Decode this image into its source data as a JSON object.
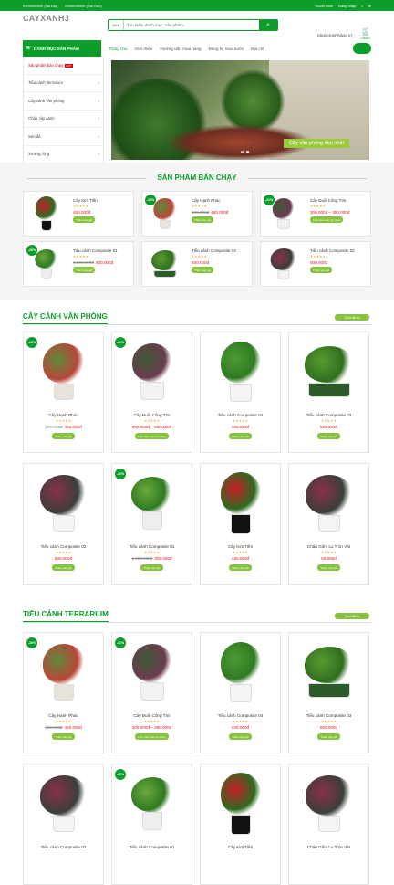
{
  "topbar": {
    "hn": "0909098909 (Hà Nội)",
    "sg": "0909098909 (Sài Gòn)",
    "pay": "Thanh toán",
    "signin": "Đăng nhập",
    "fb": "f",
    "tw": "tw"
  },
  "header": {
    "logo": "CAYXANH3",
    "search_select": "All",
    "search_placeholder": "Tìm kiếm danh mục, sản phẩm...",
    "search_icon": "search-icon",
    "account": "ĐĂNG NHẬP/ĐĂNG KÝ",
    "cart": "GIỎ HÀNG",
    "cart_count": "0"
  },
  "nav": {
    "category_btn": "DANH MỤC SẢN PHẨM",
    "items": [
      "Trang chủ",
      "Giới thiệu",
      "Hướng dẫn mua hàng",
      "Đăng ký mua buôn",
      "Địa chỉ"
    ]
  },
  "categories": [
    "Sản phẩm bán chạy",
    "Tiểu cảnh Terrarium",
    "Cây cảnh văn phòng",
    "Chậu cây cảnh",
    "Sen đá",
    "Xương rồng",
    "Phụ kiện tiểu cảnh"
  ],
  "hot_label": "HOT",
  "hero": {
    "tag": "Cây văn phòng đẹp nhất"
  },
  "bestseller": {
    "title": "SẢN PHẨM BÁN CHẠY",
    "items": [
      {
        "name": "Cây Kim Tiền",
        "old": "",
        "price": "450.000đ",
        "btn": "Thêm vào giỏ",
        "sale": ""
      },
      {
        "name": "Cây Hạnh Phúc",
        "old": "500.000đ",
        "price": "450.000đ",
        "btn": "Thêm vào giỏ",
        "sale": "-10%"
      },
      {
        "name": "Cây Đuôi Công Tím",
        "old": "",
        "price": "300.000đ – 390.000đ",
        "btn": "Lựa chọn các tùy chọn",
        "sale": "-21%"
      },
      {
        "name": "Tiểu cảnh Composite 01",
        "old": "1.000.000đ",
        "price": "800.000đ",
        "btn": "Thêm vào giỏ",
        "sale": "-20%"
      },
      {
        "name": "Tiểu cảnh Composite 03",
        "old": "",
        "price": "500.000đ",
        "btn": "Thêm vào giỏ",
        "sale": ""
      },
      {
        "name": "Tiểu cảnh Composite 02",
        "old": "",
        "price": "500.000đ",
        "btn": "Thêm vào giỏ",
        "sale": ""
      }
    ]
  },
  "office": {
    "title": "CÂY CẢNH VĂN PHÒNG",
    "viewall": "Xem tất cả",
    "items": [
      {
        "name": "Cây Hạnh Phúc",
        "old": "500.000đ",
        "price": "450.000đ",
        "btn": "Thêm vào giỏ",
        "sale": "-10%"
      },
      {
        "name": "Cây Đuôi Công Tím",
        "old": "",
        "price": "300.000đ – 390.000đ",
        "btn": "Lựa chọn các tùy chọn",
        "sale": "-21%"
      },
      {
        "name": "Tiểu cảnh Composite 04",
        "old": "",
        "price": "500.000đ",
        "btn": "Thêm vào giỏ",
        "sale": ""
      },
      {
        "name": "Tiểu cảnh Composite 03",
        "old": "",
        "price": "500.000đ",
        "btn": "Thêm vào giỏ",
        "sale": ""
      },
      {
        "name": "Tiểu cảnh Composite 02",
        "old": "",
        "price": "500.000đ",
        "btn": "Thêm vào giỏ",
        "sale": ""
      },
      {
        "name": "Tiểu cảnh Composite 01",
        "old": "1.000.000đ",
        "price": "800.000đ",
        "btn": "Thêm vào giỏ",
        "sale": "-20%"
      },
      {
        "name": "Cây Kim Tiền",
        "old": "",
        "price": "450.000đ",
        "btn": "Thêm vào giỏ",
        "sale": ""
      },
      {
        "name": "Chậu Gốm Lu Tròn Vát",
        "old": "",
        "price": "50.000đ",
        "btn": "Thêm vào giỏ",
        "sale": ""
      }
    ]
  },
  "terrarium": {
    "title": "TIỂU CẢNH TERRARIUM",
    "viewall": "Xem tất cả",
    "items": [
      {
        "name": "Cây Hạnh Phúc",
        "old": "500.000đ",
        "price": "450.000đ",
        "btn": "Thêm vào giỏ",
        "sale": "-10%"
      },
      {
        "name": "Cây Đuôi Công Tím",
        "old": "",
        "price": "300.000đ – 390.000đ",
        "btn": "Lựa chọn các tùy chọn",
        "sale": "-21%"
      },
      {
        "name": "Tiểu cảnh Composite 04",
        "old": "",
        "price": "500.000đ",
        "btn": "Thêm vào giỏ",
        "sale": ""
      },
      {
        "name": "Tiểu cảnh Composite 03",
        "old": "",
        "price": "500.000đ",
        "btn": "Thêm vào giỏ",
        "sale": ""
      },
      {
        "name": "Tiểu cảnh Composite 02",
        "old": "",
        "price": "",
        "btn": "",
        "sale": ""
      },
      {
        "name": "Tiểu cảnh Composite 01",
        "old": "",
        "price": "",
        "btn": "",
        "sale": "-20%"
      },
      {
        "name": "Cây Kim Tiền",
        "old": "",
        "price": "",
        "btn": "",
        "sale": ""
      },
      {
        "name": "Chậu Gốm Lu Tròn Vát",
        "old": "",
        "price": "",
        "btn": "",
        "sale": ""
      }
    ]
  },
  "stars": "★★★★★",
  "colors": {
    "brand": "#0c9d2a",
    "accent": "#86c43d",
    "price": "#e8111d",
    "star": "#f5a623"
  }
}
